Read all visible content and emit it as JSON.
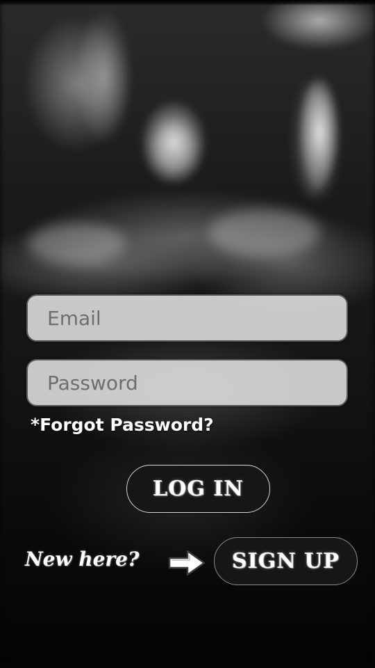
{
  "login_form": {
    "email": {
      "value": "",
      "placeholder": "Email"
    },
    "password": {
      "value": "",
      "placeholder": "Password"
    },
    "forgot_password_label": "*Forgot Password?",
    "login_label": "LOG IN"
  },
  "signup_prompt": {
    "label": "New here?",
    "arrow_icon": "right-arrow-icon",
    "signup_label": "SIGN UP"
  },
  "background": {
    "description_icon": "concert-crowd-background"
  },
  "colors": {
    "field_background": "#e1e1e1",
    "button_background": "#161616",
    "text_light": "#ffffff"
  }
}
